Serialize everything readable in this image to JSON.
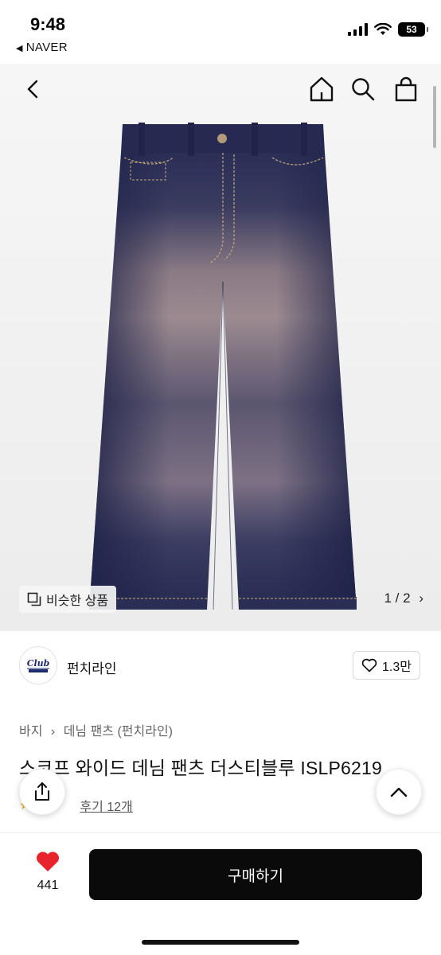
{
  "status_bar": {
    "time": "9:48",
    "back_app": "NAVER",
    "battery": "53"
  },
  "nav": {
    "icons": [
      "back-arrow-icon",
      "home-icon",
      "search-icon",
      "shopping-bag-icon"
    ]
  },
  "product_image": {
    "similar_label": "비슷한 상품",
    "pager": "1 / 2"
  },
  "brand": {
    "name": "펀치라인",
    "like_count": "1.3만"
  },
  "product": {
    "breadcrumb_category": "바지",
    "breadcrumb_sub": "데님 팬츠 (펀치라인)",
    "title": "스코프 와이드 데님 팬츠 더스티블루 ISLP6219",
    "review_link": "후기 12개"
  },
  "bottom_bar": {
    "wish_count": "441",
    "buy_label": "구매하기"
  },
  "colors": {
    "accent_red": "#e8232c",
    "buy_button": "#0a0a0a",
    "denim": "#2a2f57"
  }
}
